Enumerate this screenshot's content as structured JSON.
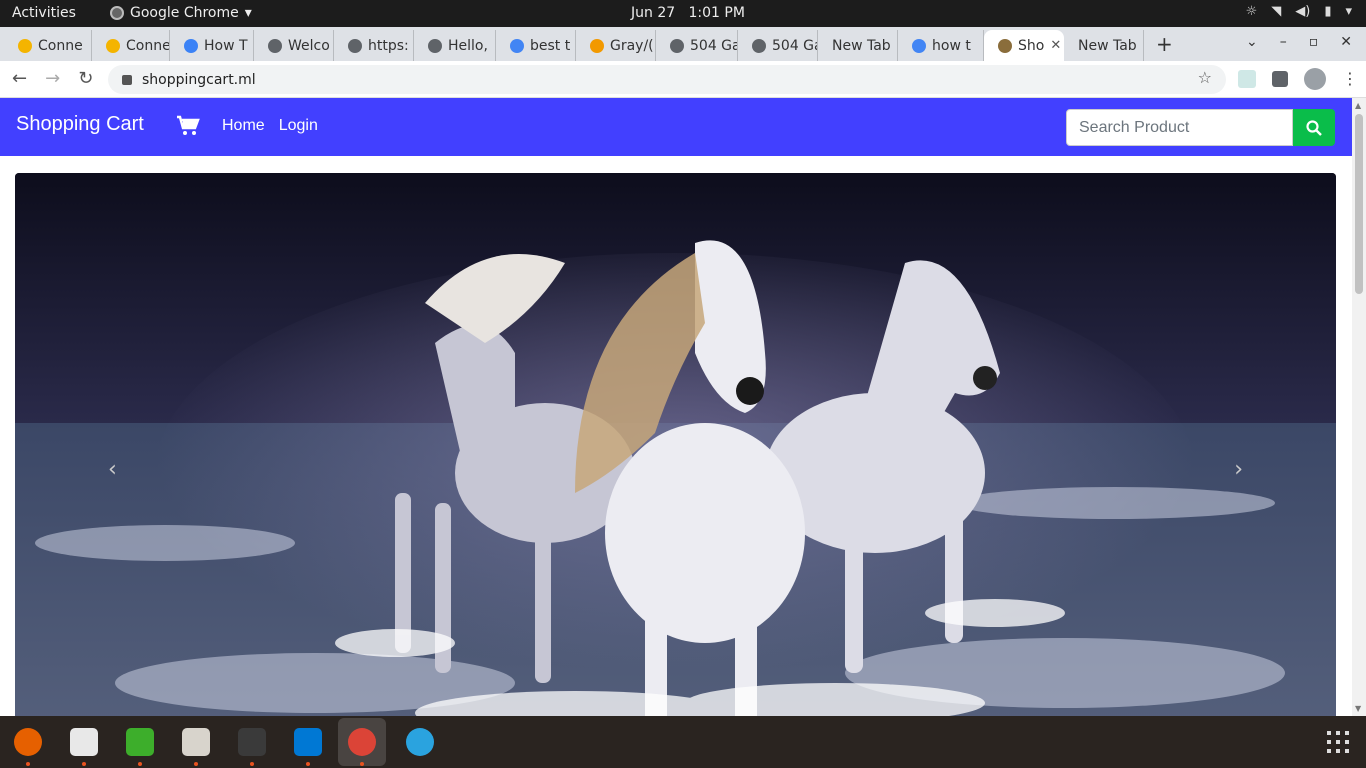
{
  "system_bar": {
    "activities": "Activities",
    "app_name": "Google Chrome",
    "date": "Jun 27",
    "time": "1:01 PM"
  },
  "browser": {
    "tabs": [
      {
        "label": "Conne",
        "favicon": "box-icon",
        "color": "#f4b400"
      },
      {
        "label": "Conne",
        "favicon": "box-icon",
        "color": "#f4b400"
      },
      {
        "label": "How T",
        "favicon": "spin-icon",
        "color": "#3b82f6"
      },
      {
        "label": "Welco",
        "favicon": "globe-icon",
        "color": "#5f6368"
      },
      {
        "label": "https:",
        "favicon": "globe-icon",
        "color": "#5f6368"
      },
      {
        "label": "Hello,",
        "favicon": "globe-icon",
        "color": "#5f6368"
      },
      {
        "label": "best t",
        "favicon": "google-icon",
        "color": "#4285f4"
      },
      {
        "label": "Gray/(",
        "favicon": "r-icon",
        "color": "#f29900"
      },
      {
        "label": "504 Ga",
        "favicon": "globe-icon",
        "color": "#5f6368"
      },
      {
        "label": "504 Ga",
        "favicon": "globe-icon",
        "color": "#5f6368"
      },
      {
        "label": "New Tab",
        "favicon": "",
        "color": ""
      },
      {
        "label": "how t",
        "favicon": "google-icon",
        "color": "#4285f4"
      },
      {
        "label": "Sho",
        "favicon": "cart-icon",
        "color": "#8a6d3b"
      },
      {
        "label": "New Tab",
        "favicon": "",
        "color": ""
      }
    ],
    "active_tab_index": 12,
    "url": "shoppingcart.ml"
  },
  "site": {
    "brand": "Shopping Cart",
    "nav_home": "Home",
    "nav_login": "Login",
    "search_placeholder": "Search Product",
    "accent_color": "#4240ff",
    "search_button_color": "#0abd4a"
  },
  "carousel": {
    "prev_glyph": "‹",
    "next_glyph": "›",
    "image_subject": "three white horses running through ocean waves"
  },
  "dock": {
    "apps": [
      "firefox-icon",
      "text-editor-icon",
      "rocket-icon",
      "files-icon",
      "terminal-icon",
      "vscode-icon",
      "chrome-icon",
      "telegram-icon"
    ]
  }
}
